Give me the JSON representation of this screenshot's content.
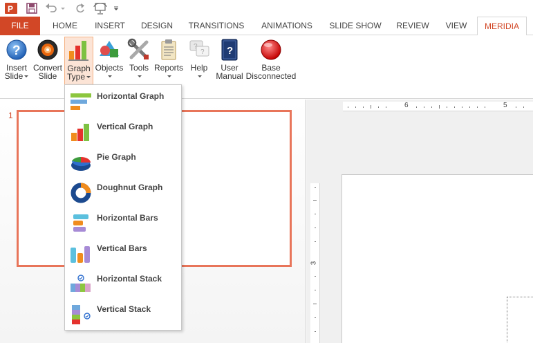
{
  "colors": {
    "accent": "#d24726",
    "file_tab_bg": "#d24726",
    "thumb_border": "#e8755a",
    "active_button_bg": "#fce4d6"
  },
  "qat": {
    "icons": [
      "powerpoint-logo-icon",
      "save-icon",
      "undo-icon",
      "redo-icon",
      "present-from-start-icon",
      "customize-qat-icon"
    ]
  },
  "tabs": [
    {
      "id": "file",
      "label": "FILE"
    },
    {
      "id": "home",
      "label": "HOME"
    },
    {
      "id": "insert",
      "label": "INSERT"
    },
    {
      "id": "design",
      "label": "DESIGN"
    },
    {
      "id": "transitions",
      "label": "TRANSITIONS"
    },
    {
      "id": "animations",
      "label": "ANIMATIONS"
    },
    {
      "id": "slideshow",
      "label": "SLIDE SHOW"
    },
    {
      "id": "review",
      "label": "REVIEW"
    },
    {
      "id": "view",
      "label": "VIEW"
    },
    {
      "id": "meridia",
      "label": "MERIDIA",
      "active": true
    }
  ],
  "ribbon": {
    "insert_slide": {
      "line1": "Insert",
      "line2": "Slide",
      "icon": "help-question-icon"
    },
    "convert_slide": {
      "line1": "Convert",
      "line2": "Slide",
      "icon": "convert-disc-icon"
    },
    "graph_type": {
      "line1": "Graph",
      "line2": "Type",
      "icon": "bar-graph-icon"
    },
    "objects": {
      "line1": "Objects",
      "icon": "objects-shapes-icon"
    },
    "tools": {
      "line1": "Tools",
      "icon": "tools-wrench-icon"
    },
    "reports": {
      "line1": "Reports",
      "icon": "reports-clipboard-icon"
    },
    "help": {
      "line1": "Help",
      "icon": "help-speech-icon"
    },
    "user_manual": {
      "line1": "User",
      "line2": "Manual",
      "icon": "user-manual-book-icon"
    },
    "base_status": {
      "line1": "Base",
      "line2": "Disconnected",
      "icon": "red-status-light-icon"
    }
  },
  "graph_menu": {
    "items": [
      {
        "label": "Horizontal Graph",
        "icon": "horizontal-graph-icon"
      },
      {
        "label": "Vertical Graph",
        "icon": "vertical-graph-icon"
      },
      {
        "label": "Pie Graph",
        "icon": "pie-graph-icon"
      },
      {
        "label": "Doughnut Graph",
        "icon": "doughnut-graph-icon"
      },
      {
        "label": "Horizontal Bars",
        "icon": "horizontal-bars-icon"
      },
      {
        "label": "Vertical Bars",
        "icon": "vertical-bars-icon"
      },
      {
        "label": "Horizontal Stack",
        "icon": "horizontal-stack-icon"
      },
      {
        "label": "Vertical Stack",
        "icon": "vertical-stack-icon"
      }
    ]
  },
  "thumbnails": {
    "slide_number": "1"
  },
  "rulers": {
    "horizontal_labels": [
      "6",
      "5"
    ],
    "vertical_labels": [
      "3"
    ]
  }
}
